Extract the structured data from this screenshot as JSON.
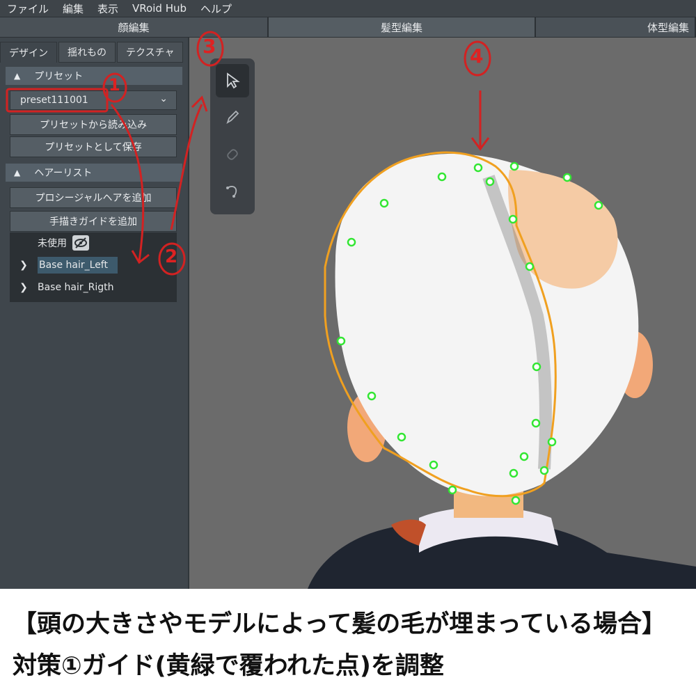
{
  "menu": [
    "ファイル",
    "編集",
    "表示",
    "VRoid Hub",
    "ヘルプ"
  ],
  "modes": [
    "顔編集",
    "髪型編集",
    "体型編集"
  ],
  "subtabs": [
    "デザイン",
    "揺れもの",
    "テクスチャ"
  ],
  "preset": {
    "header": "プリセット",
    "selected": "preset111001",
    "load_button": "プリセットから読み込み",
    "save_button": "プリセットとして保存"
  },
  "hairlist": {
    "header": "ヘアーリスト",
    "add_procedural": "プロシージャルヘアを追加",
    "add_guide": "手描きガイドを追加",
    "unused_label": "未使用",
    "items": [
      "Base hair_Left",
      "Base hair_Rigth"
    ]
  },
  "tools": [
    "cursor-icon",
    "pencil-icon",
    "eraser-icon",
    "curve-icon"
  ],
  "annotations": [
    "1",
    "2",
    "3",
    "4"
  ],
  "caption": {
    "line1": "【頭の大きさやモデルによって髪の毛が埋まっている場合】",
    "line2": "対策①ガイド(黄緑で覆われた点)を調整"
  },
  "colors": {
    "guide_points": "#33e633",
    "selection_outline": "#f0a020",
    "annotation": "#d22222"
  }
}
